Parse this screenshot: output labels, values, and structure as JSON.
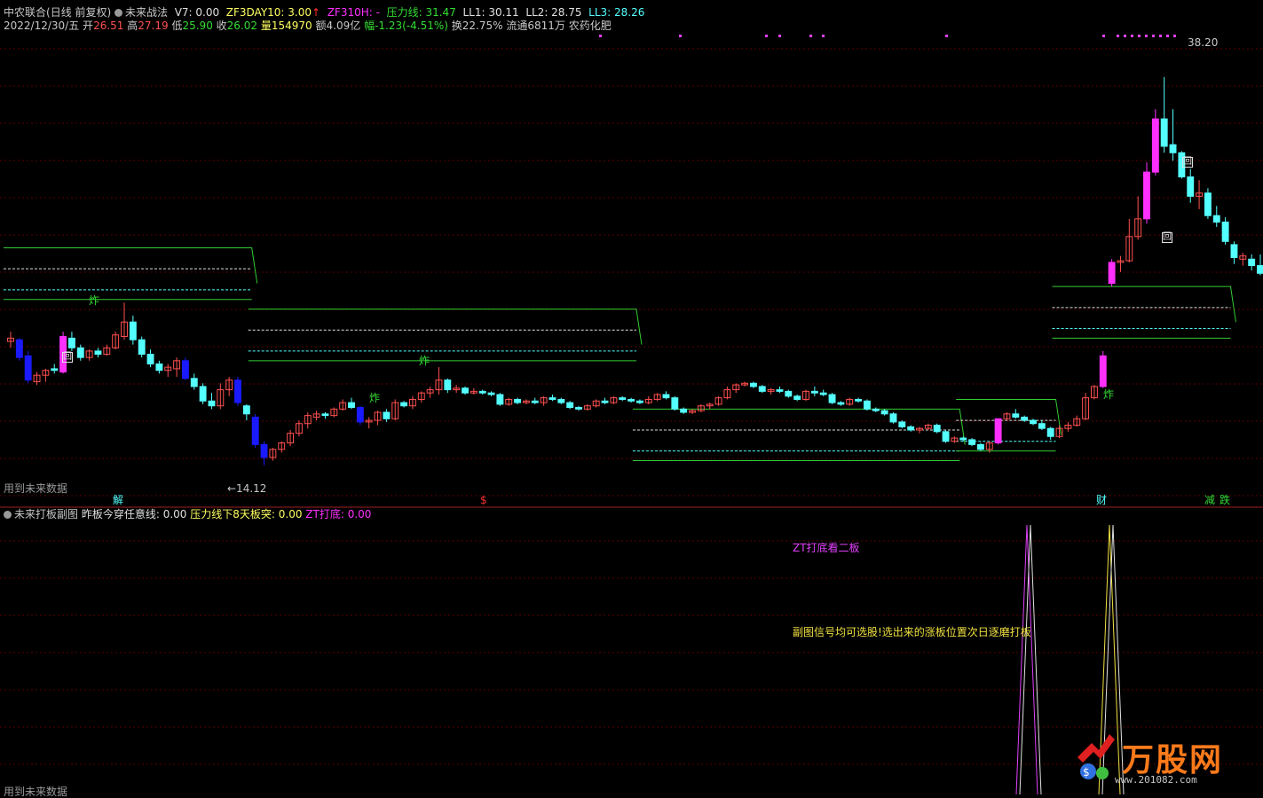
{
  "header": {
    "stock_name": "中农联合",
    "period": "(日线 前复权)",
    "indicator_name": "未来战法",
    "v7": "V7: 0.00",
    "zf3day10": "ZF3DAY10: 3.00",
    "arrow_up": "↑",
    "zf310h": "ZF310H: -",
    "pressure_line": "压力线: 31.47",
    "ll1": "LL1: 30.11",
    "ll2": "LL2: 28.75",
    "ll3": "LL3: 28.26"
  },
  "quote": {
    "date": "2022/12/30/五",
    "open_label": "开",
    "open": "26.51",
    "high_label": "高",
    "high": "27.19",
    "low_label": "低",
    "low": "25.90",
    "close_label": "收",
    "close": "26.02",
    "volume": "量154970",
    "amount": "额4.09亿",
    "change": "幅-1.23(-4.51%)",
    "turnover": "换22.75%",
    "float": "流通6811万",
    "sector": "农药化肥"
  },
  "main_labels": {
    "max_price": "38.20",
    "min_price": "←14.12",
    "future_data": "用到未来数据",
    "jie": "解",
    "dollar": "$",
    "cai": "财",
    "jian": "减",
    "die": "跌",
    "zha": "炸",
    "hui": "回"
  },
  "sub_header": {
    "name": "未来打板副图",
    "line1": "昨板今穿任意线: 0.00",
    "line2": "压力线下8天板突: 0.00",
    "line3": "ZT打底: 0.00"
  },
  "sub_labels": {
    "note1": "ZT打底看二板",
    "note2": "副图信号均可选股!选出来的涨板位置次日逐磨打板",
    "future_data": "用到未来数据"
  },
  "watermark": {
    "brand": "万股网",
    "url": "www.201082.com"
  },
  "colors": {
    "bg": "#000000",
    "up": "#ff5050",
    "down": "#54ffff",
    "zt_up": "#ff30ff",
    "big_down": "#1a1aff",
    "green_signal": "#22dd22",
    "support_line": "#33cc33",
    "dash_white": "#e0e0e0",
    "dash_cyan": "#54ffff",
    "grid": "#5a0000",
    "magenta": "#e040fb",
    "yellow": "#f0e040"
  },
  "chart_data": {
    "type": "candlestick",
    "ylim": [
      13.0,
      40.5
    ],
    "dates_note": "",
    "candles": [
      [
        21.8,
        22.4,
        21.4,
        22.0
      ],
      [
        21.9,
        22.0,
        20.6,
        20.8
      ],
      [
        20.9,
        21.2,
        19.2,
        19.4
      ],
      [
        19.3,
        19.9,
        19.1,
        19.7
      ],
      [
        19.7,
        20.1,
        19.3,
        20.0
      ],
      [
        20.1,
        20.4,
        19.8,
        20.0
      ],
      [
        19.9,
        22.4,
        19.8,
        22.1
      ],
      [
        22.0,
        22.4,
        21.2,
        21.4
      ],
      [
        21.4,
        21.6,
        20.6,
        20.8
      ],
      [
        20.8,
        21.3,
        20.6,
        21.2
      ],
      [
        21.2,
        21.4,
        20.8,
        21.0
      ],
      [
        21.0,
        21.6,
        20.9,
        21.4
      ],
      [
        21.4,
        22.4,
        21.3,
        22.2
      ],
      [
        22.1,
        24.2,
        21.9,
        23.0
      ],
      [
        23.0,
        23.4,
        21.6,
        21.9
      ],
      [
        21.9,
        22.1,
        20.8,
        21.0
      ],
      [
        21.0,
        21.3,
        20.2,
        20.4
      ],
      [
        20.4,
        20.6,
        19.8,
        20.0
      ],
      [
        20.0,
        20.4,
        19.6,
        20.2
      ],
      [
        20.1,
        20.8,
        19.6,
        20.6
      ],
      [
        20.6,
        20.8,
        19.4,
        19.5
      ],
      [
        19.5,
        19.8,
        18.8,
        19.0
      ],
      [
        19.0,
        19.2,
        17.9,
        18.1
      ],
      [
        18.1,
        18.6,
        17.6,
        17.8
      ],
      [
        17.8,
        19.2,
        17.6,
        18.8
      ],
      [
        18.8,
        19.6,
        18.4,
        19.4
      ],
      [
        19.4,
        19.6,
        17.8,
        18.0
      ],
      [
        17.8,
        17.9,
        16.9,
        17.3
      ],
      [
        17.1,
        17.3,
        15.2,
        15.4
      ],
      [
        15.4,
        15.6,
        14.12,
        14.6
      ],
      [
        14.6,
        15.2,
        14.4,
        15.1
      ],
      [
        15.1,
        15.6,
        14.9,
        15.5
      ],
      [
        15.5,
        16.3,
        15.3,
        16.1
      ],
      [
        16.1,
        16.9,
        15.9,
        16.7
      ],
      [
        16.7,
        17.4,
        16.4,
        17.2
      ],
      [
        17.1,
        17.5,
        16.9,
        17.3
      ],
      [
        17.3,
        17.4,
        17.0,
        17.2
      ],
      [
        17.2,
        17.7,
        17.1,
        17.6
      ],
      [
        17.6,
        18.2,
        17.5,
        18.0
      ],
      [
        18.0,
        18.3,
        17.6,
        17.7
      ],
      [
        17.7,
        17.8,
        16.6,
        16.8
      ],
      [
        16.8,
        17.1,
        16.4,
        16.9
      ],
      [
        16.9,
        17.5,
        16.6,
        17.4
      ],
      [
        17.4,
        17.6,
        16.8,
        17.0
      ],
      [
        17.0,
        18.2,
        16.9,
        18.0
      ],
      [
        18.0,
        18.1,
        17.7,
        17.8
      ],
      [
        17.8,
        18.4,
        17.6,
        18.2
      ],
      [
        18.2,
        18.7,
        18.0,
        18.6
      ],
      [
        18.6,
        19.0,
        18.3,
        18.8
      ],
      [
        18.8,
        20.2,
        18.5,
        19.4
      ],
      [
        19.4,
        19.5,
        18.6,
        18.8
      ],
      [
        18.8,
        19.1,
        18.6,
        18.9
      ],
      [
        18.9,
        19.0,
        18.5,
        18.6
      ],
      [
        18.6,
        18.9,
        18.5,
        18.7
      ],
      [
        18.7,
        18.8,
        18.5,
        18.6
      ],
      [
        18.6,
        18.7,
        18.4,
        18.5
      ],
      [
        18.5,
        18.6,
        17.8,
        17.9
      ],
      [
        17.9,
        18.3,
        17.8,
        18.2
      ],
      [
        18.2,
        18.3,
        17.9,
        18.0
      ],
      [
        18.0,
        18.2,
        17.9,
        18.1
      ],
      [
        18.1,
        18.3,
        17.9,
        18.0
      ],
      [
        18.0,
        18.4,
        17.8,
        18.3
      ],
      [
        18.3,
        18.5,
        18.1,
        18.2
      ],
      [
        18.2,
        18.3,
        17.9,
        18.0
      ],
      [
        18.0,
        18.1,
        17.6,
        17.7
      ],
      [
        17.7,
        17.8,
        17.5,
        17.6
      ],
      [
        17.6,
        17.9,
        17.5,
        17.8
      ],
      [
        17.8,
        18.2,
        17.7,
        18.1
      ],
      [
        18.1,
        18.3,
        17.9,
        18.0
      ],
      [
        18.0,
        18.4,
        17.9,
        18.3
      ],
      [
        18.3,
        18.4,
        18.1,
        18.2
      ],
      [
        18.2,
        18.3,
        18.0,
        18.1
      ],
      [
        18.1,
        18.2,
        17.9,
        18.0
      ],
      [
        18.0,
        18.4,
        17.9,
        18.2
      ],
      [
        18.2,
        18.6,
        18.1,
        18.5
      ],
      [
        18.5,
        18.7,
        18.2,
        18.3
      ],
      [
        18.3,
        18.4,
        17.5,
        17.6
      ],
      [
        17.6,
        17.7,
        17.3,
        17.4
      ],
      [
        17.4,
        17.6,
        17.3,
        17.5
      ],
      [
        17.5,
        17.9,
        17.4,
        17.8
      ],
      [
        17.8,
        18.0,
        17.6,
        17.9
      ],
      [
        17.9,
        18.4,
        17.8,
        18.3
      ],
      [
        18.3,
        19.0,
        18.2,
        18.8
      ],
      [
        18.8,
        19.2,
        18.6,
        19.1
      ],
      [
        19.1,
        19.3,
        19.0,
        19.2
      ],
      [
        19.2,
        19.3,
        18.9,
        19.0
      ],
      [
        19.0,
        19.1,
        18.6,
        18.7
      ],
      [
        18.7,
        18.9,
        18.5,
        18.8
      ],
      [
        18.8,
        19.0,
        18.6,
        18.7
      ],
      [
        18.7,
        18.8,
        18.3,
        18.4
      ],
      [
        18.4,
        18.5,
        18.1,
        18.2
      ],
      [
        18.2,
        18.8,
        18.1,
        18.7
      ],
      [
        18.7,
        19.0,
        18.4,
        18.6
      ],
      [
        18.6,
        18.8,
        18.4,
        18.5
      ],
      [
        18.5,
        18.6,
        17.9,
        18.0
      ],
      [
        18.0,
        18.1,
        17.8,
        17.9
      ],
      [
        17.9,
        18.3,
        17.8,
        18.2
      ],
      [
        18.2,
        18.3,
        18.0,
        18.1
      ],
      [
        18.1,
        18.2,
        17.5,
        17.6
      ],
      [
        17.6,
        17.7,
        17.4,
        17.5
      ],
      [
        17.5,
        17.6,
        17.2,
        17.3
      ],
      [
        17.3,
        17.4,
        16.7,
        16.8
      ],
      [
        16.8,
        16.9,
        16.4,
        16.5
      ],
      [
        16.5,
        16.6,
        16.2,
        16.3
      ],
      [
        16.3,
        16.5,
        16.1,
        16.4
      ],
      [
        16.4,
        16.7,
        16.3,
        16.6
      ],
      [
        16.6,
        16.7,
        16.1,
        16.2
      ],
      [
        16.2,
        16.3,
        15.5,
        15.6
      ],
      [
        15.6,
        15.9,
        15.5,
        15.8
      ],
      [
        15.8,
        15.9,
        15.6,
        15.7
      ],
      [
        15.7,
        15.8,
        15.3,
        15.4
      ],
      [
        15.4,
        15.5,
        15.0,
        15.1
      ],
      [
        15.1,
        15.6,
        14.9,
        15.5
      ],
      [
        15.5,
        17.0,
        15.4,
        17.0
      ],
      [
        17.0,
        17.4,
        16.9,
        17.3
      ],
      [
        17.3,
        17.6,
        17.0,
        17.1
      ],
      [
        17.1,
        17.2,
        16.8,
        16.9
      ],
      [
        16.9,
        17.0,
        16.6,
        16.7
      ],
      [
        16.7,
        16.9,
        16.3,
        16.4
      ],
      [
        16.4,
        16.5,
        15.7,
        15.9
      ],
      [
        15.9,
        16.6,
        15.8,
        16.4
      ],
      [
        16.4,
        16.8,
        16.2,
        16.6
      ],
      [
        16.6,
        17.2,
        16.5,
        17.0
      ],
      [
        17.0,
        18.6,
        16.9,
        18.3
      ],
      [
        18.3,
        19.1,
        18.2,
        19.0
      ],
      [
        19.0,
        21.2,
        18.9,
        20.9
      ],
      [
        25.4,
        26.9,
        25.2,
        26.7
      ],
      [
        26.7,
        27.1,
        26.1,
        26.8
      ],
      [
        26.8,
        29.4,
        26.7,
        28.3
      ],
      [
        28.3,
        30.8,
        28.1,
        29.4
      ],
      [
        29.4,
        32.9,
        29.1,
        32.3
      ],
      [
        32.3,
        36.2,
        32.1,
        35.6
      ],
      [
        35.6,
        38.2,
        33.5,
        33.9
      ],
      [
        34.0,
        36.2,
        33.0,
        33.5
      ],
      [
        33.5,
        33.6,
        31.9,
        32.0
      ],
      [
        32.0,
        32.5,
        30.4,
        30.8
      ],
      [
        30.8,
        31.8,
        30.0,
        31.0
      ],
      [
        31.0,
        31.3,
        29.4,
        29.6
      ],
      [
        29.6,
        30.2,
        28.9,
        29.2
      ],
      [
        29.2,
        29.5,
        27.8,
        28.0
      ],
      [
        27.8,
        28.0,
        26.6,
        27.0
      ],
      [
        26.9,
        27.3,
        26.5,
        27.1
      ],
      [
        26.9,
        27.2,
        26.2,
        26.5
      ],
      [
        26.5,
        27.19,
        25.9,
        26.02
      ]
    ],
    "pressure_lines": [
      {
        "name": "压力线",
        "segments": [
          [
            0,
            28,
            27.6
          ],
          [
            28,
            72,
            23.8
          ],
          [
            72,
            109,
            17.6
          ],
          [
            109,
            120,
            18.2
          ],
          [
            120,
            140,
            25.2
          ]
        ]
      }
    ],
    "max_label": "38.20",
    "min_label": "14.12"
  }
}
